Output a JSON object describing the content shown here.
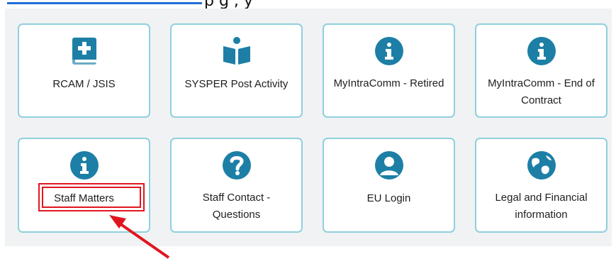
{
  "top_strip": {
    "cut_text": "p                                              g ,                  y"
  },
  "tiles": [
    {
      "label": "RCAM / JSIS",
      "icon": "medical-book-icon"
    },
    {
      "label": "SYSPER Post Activity",
      "icon": "reading-person-icon"
    },
    {
      "label": "MyIntraComm - Retired",
      "icon": "info-icon"
    },
    {
      "label": "MyIntraComm - End of Contract",
      "icon": "info-icon"
    },
    {
      "label": "Staff Matters",
      "icon": "info-icon"
    },
    {
      "label": "Staff Contact - Questions",
      "icon": "question-icon"
    },
    {
      "label": "EU Login",
      "icon": "user-icon"
    },
    {
      "label": "Legal and Financial information",
      "icon": "globe-icon"
    }
  ],
  "colors": {
    "icon": "#1d7fa6",
    "tile_border": "#8fd0dd",
    "panel_bg": "#f1f2f4",
    "annotation": "#e0161f",
    "link": "#1f6fd6"
  }
}
